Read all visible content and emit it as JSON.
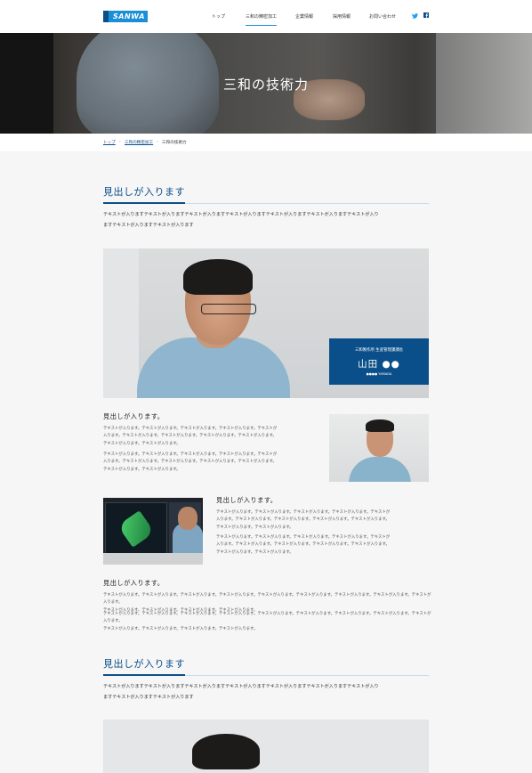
{
  "header": {
    "logo_text": "SANWA",
    "nav": [
      "トップ",
      "三和の精密加工",
      "企業情報",
      "採用情報",
      "お問い合わせ"
    ],
    "active_nav_index": 1,
    "social": {
      "twitter": "twitter-icon",
      "facebook": "facebook-icon"
    }
  },
  "hero": {
    "title": "三和の技術力"
  },
  "breadcrumb": [
    "トップ",
    "三和の精密加工",
    "三和の技術力"
  ],
  "sections": [
    {
      "heading": "見出しが入ります",
      "lead_line1": "テキストが入りますテキストが入りますテキストが入りますテキストが入りますテキストが入りますテキストが入りますテキストが入り",
      "lead_line2": "ますテキストが入りますテキストが入ります"
    },
    {
      "heading": "見出しが入ります",
      "lead_line1": "テキストが入りますテキストが入りますテキストが入りますテキストが入りますテキストが入りますテキストが入りますテキストが入り",
      "lead_line2": "ますテキストが入りますテキストが入ります"
    }
  ],
  "namecard": {
    "affiliation": "三和製作所 生産管理課課長",
    "name": "山田 ●●",
    "romaji": "●●●● YAMADA"
  },
  "blocks": [
    {
      "subhead": "見出しが入ります。",
      "p1": [
        "テキストが入ります。テキストが入ります。テキストが入ります。テキストが入ります。テキストが",
        "入ります。テキストが入ります。テキストが入ります。テキストが入ります。テキストが入ります。",
        "テキストが入ります。テキストが入ります。"
      ],
      "p2": [
        "テキストが入ります。テキストが入ります。テキストが入ります。テキストが入ります。テキストが",
        "入ります。テキストが入ります。テキストが入ります。テキストが入ります。テキストが入ります。",
        "テキストが入ります。テキストが入ります。"
      ]
    },
    {
      "subhead": "見出しが入ります。",
      "p1": [
        "テキストが入ります。テキストが入ります。テキストが入ります。テキストが入ります。テキストが",
        "入ります。テキストが入ります。テキストが入ります。テキストが入ります。テキストが入ります。",
        "テキストが入ります。テキストが入ります。"
      ],
      "p2": [
        "テキストが入ります。テキストが入ります。テキストが入ります。テキストが入ります。テキストが",
        "入ります。テキストが入ります。テキストが入ります。テキストが入ります。テキストが入ります。",
        "テキストが入ります。テキストが入ります。"
      ]
    },
    {
      "subhead": "見出しが入ります。",
      "p1": [
        "テキストが入ります。テキストが入ります。テキストが入ります。テキストが入ります。テキストが入ります。テキストが入ります。テキストが入ります。テキストが入ります。テキストが入ります。",
        "テキストが入ります。テキストが入ります。テキストが入ります。テキストが入ります。"
      ],
      "p2": [
        "テキストが入ります。テキストが入ります。テキストが入ります。テキストが入ります。テキストが入ります。テキストが入ります。テキストが入ります。テキストが入ります。テキストが入ります。",
        "テキストが入ります。テキストが入ります。テキストが入ります。テキストが入ります。"
      ]
    }
  ],
  "colors": {
    "brand": "#0b4f8a",
    "accent": "#1a8fd6",
    "background": "#f6f6f6"
  }
}
